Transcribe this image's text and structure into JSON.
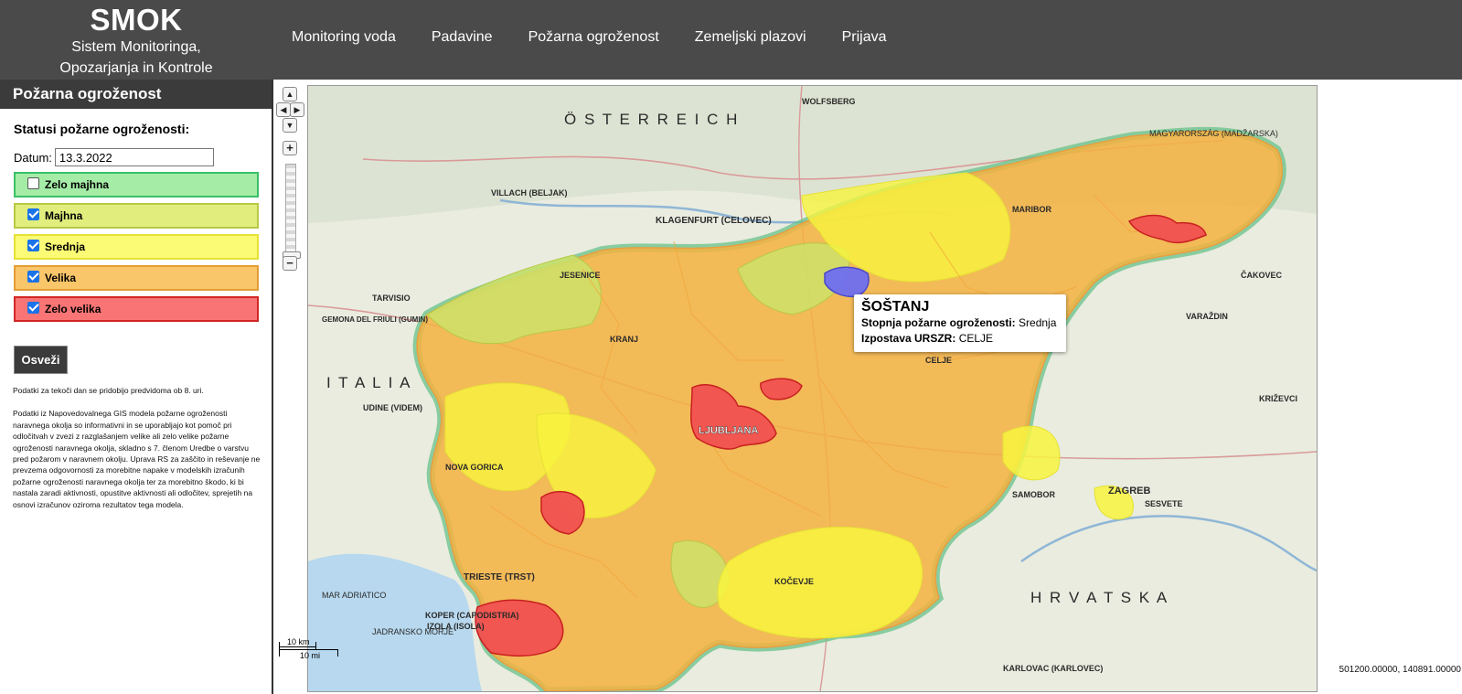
{
  "header": {
    "title": "SMOK",
    "subtitle_line1": "Sistem Monitoringa,",
    "subtitle_line2": "Opozarjanja in Kontrole",
    "nav": [
      "Monitoring voda",
      "Padavine",
      "Požarna ogroženost",
      "Zemeljski plazovi",
      "Prijava"
    ]
  },
  "sidebar": {
    "title": "Požarna ogroženost",
    "status_heading": "Statusi požarne ogroženosti:",
    "date_label": "Datum:",
    "date_value": "13.3.2022",
    "levels": [
      {
        "label": "Zelo majhna",
        "checked": false,
        "color": "#a5eca7"
      },
      {
        "label": "Majhna",
        "checked": true,
        "color": "#e1ee7e"
      },
      {
        "label": "Srednja",
        "checked": true,
        "color": "#fbfb75"
      },
      {
        "label": "Velika",
        "checked": true,
        "color": "#f9c66a"
      },
      {
        "label": "Zelo velika",
        "checked": true,
        "color": "#f97575"
      }
    ],
    "refresh_label": "Osveži",
    "note_1": "Podatki za tekoči dan se pridobijo predvidoma ob 8. uri.",
    "note_2": "Podatki iz Napovedovalnega GIS modela požarne ogroženosti naravnega okolja so informativni in se uporabljajo kot pomoč pri odločitvah v zvezi z razglašanjem velike ali zelo velike požarne ogroženosti naravnega okolja, skladno s 7. členom Uredbe o varstvu pred požarom v naravnem okolju. Uprava RS za zaščito in reševanje ne prevzema odgovornosti za morebitne napake v modelskih izračunih požarne ogroženosti naravnega okolja ter za morebitno škodo, ki bi nastala zaradi aktivnosti, opustitve aktivnosti ali odločitev, sprejetih na osnovi izračunov oziroma rezultatov tega modela."
  },
  "map": {
    "popup": {
      "title": "ŠOŠTANJ",
      "level_label": "Stopnja požarne ogroženosti:",
      "level_value": "Srednja",
      "office_label": "Izpostava URSZR:",
      "office_value": "CELJE"
    },
    "scale_km": "10 km",
    "scale_mi": "10 mi",
    "coords": "501200.00000, 140891.00000",
    "place_labels": {
      "ljubljana": "LJUBLJANA",
      "maribor": "MARIBOR",
      "klagenfurt": "KLAGENFURT (CELOVEC)",
      "zagreb": "ZAGREB",
      "trieste": "TRIESTE (TRST)",
      "koper": "KOPER (CAPODISTRIA)",
      "villach": "VILLACH (BELJAK)",
      "udine": "UDINE (VIDEM)",
      "nova_gorica": "NOVA GORICA",
      "karlovac": "KARLOVAC (KARLOVEC)",
      "krizevci": "KRIŽEVCI",
      "cakovec": "ČAKOVEC",
      "varazdin": "VARAŽDIN",
      "samobor": "SAMOBOR",
      "sesvete": "SESVETE",
      "celje": "CELJE",
      "kranj": "KRANJ",
      "jesenice": "JESENICE",
      "kocevje": "KOČEVJE",
      "wolfsberg": "WOLFSBERG",
      "tarvisio": "TARVISIO",
      "gemona": "GEMONA DEL FRIULI (GUMIN)",
      "mar_adriatico": "MAR ADRIATICO",
      "osterreich": "Ö S T E R R E I C H",
      "italia": "I T A L I A",
      "hrvatska": "H R V A T S K A",
      "magyarorszag": "MAGYARORSZÁG (MADŽARSKA)",
      "jadransko_morje": "JADRANSKO MORJE",
      "izola": "IZOLA (ISOLA)"
    }
  },
  "colors": {
    "header_bg": "#4a4a4a",
    "very_high": "#f05050",
    "high": "#f5b141",
    "medium": "#f8f43f",
    "low": "#cde26a",
    "selected_region": "#6e6ef0"
  }
}
